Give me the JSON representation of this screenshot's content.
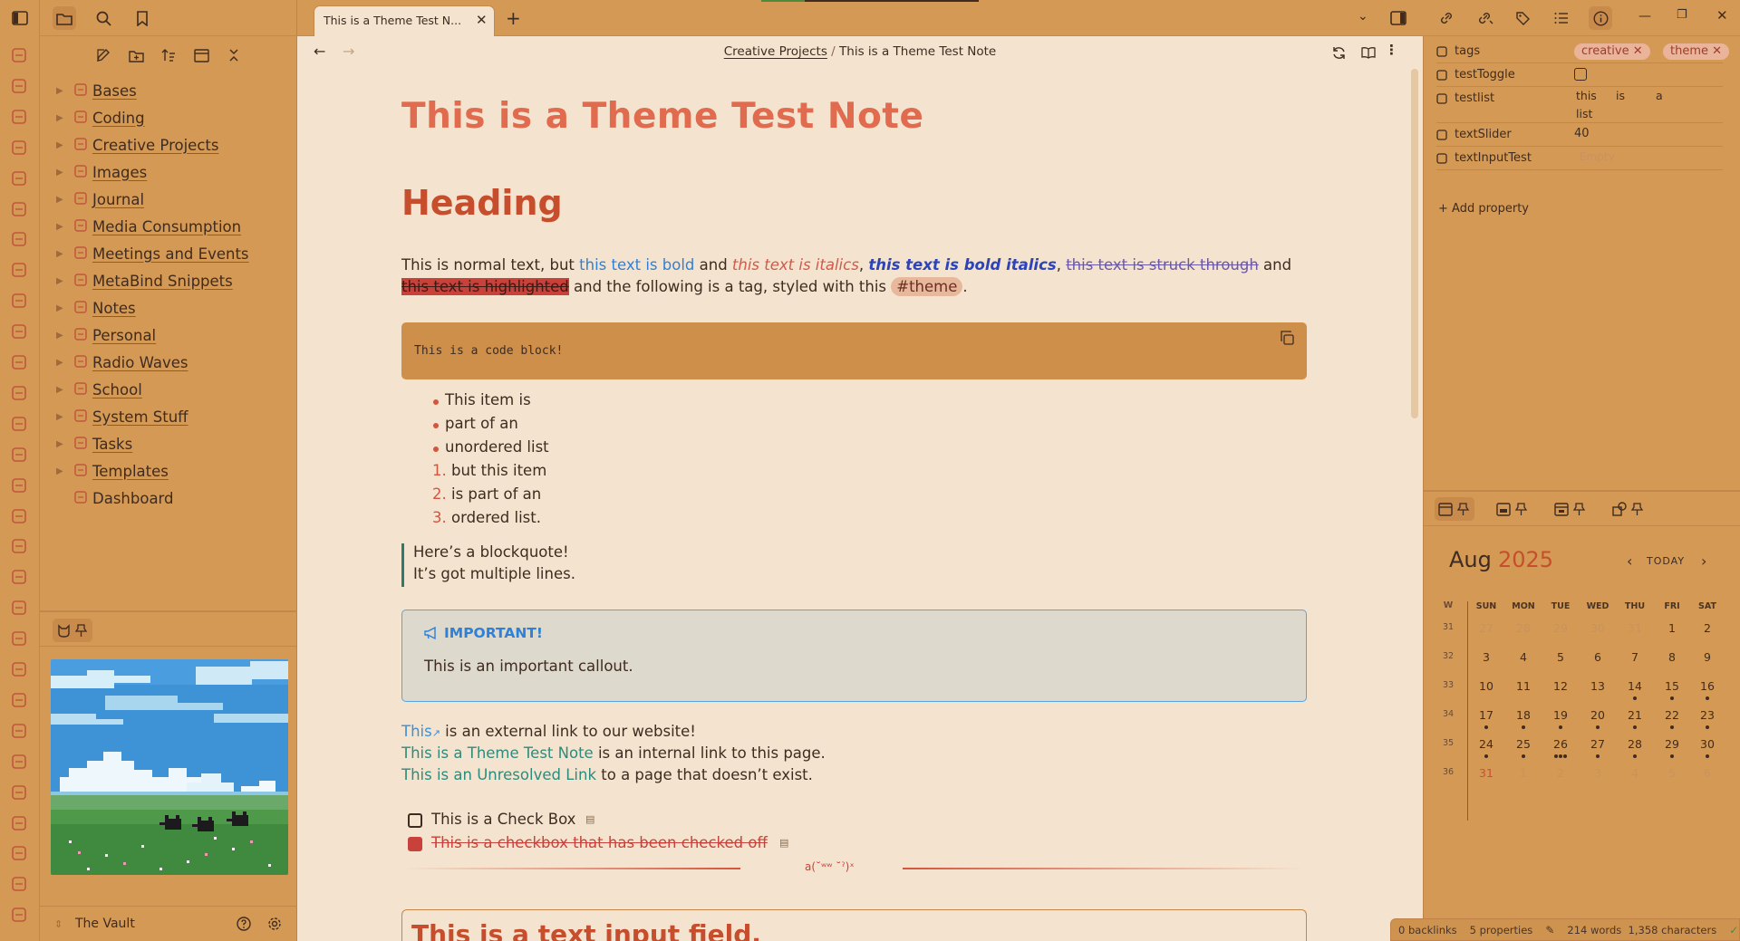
{
  "tab": {
    "title": "This is a Theme Test N..."
  },
  "breadcrumb": {
    "folder": "Creative Projects",
    "separator": "/",
    "note": "This is a Theme Test Note"
  },
  "sidebar": {
    "items": [
      {
        "label": "Bases",
        "icon": "bases-icon"
      },
      {
        "label": "Coding",
        "icon": "coding-icon"
      },
      {
        "label": "Creative Projects",
        "icon": "palette-icon"
      },
      {
        "label": "Images",
        "icon": "image-icon"
      },
      {
        "label": "Journal",
        "icon": "journal-icon"
      },
      {
        "label": "Media Consumption",
        "icon": "media-icon"
      },
      {
        "label": "Meetings and Events",
        "icon": "meetings-icon"
      },
      {
        "label": "MetaBind Snippets",
        "icon": "scissors-icon"
      },
      {
        "label": "Notes",
        "icon": "notes-icon"
      },
      {
        "label": "Personal",
        "icon": "person-icon"
      },
      {
        "label": "Radio Waves",
        "icon": "radio-icon"
      },
      {
        "label": "School",
        "icon": "school-icon"
      },
      {
        "label": "System Stuff",
        "icon": "system-icon"
      },
      {
        "label": "Tasks",
        "icon": "tasks-icon"
      },
      {
        "label": "Templates",
        "icon": "templates-icon"
      },
      {
        "label": "Dashboard",
        "icon": "dashboard-icon"
      }
    ],
    "vault_name": "The Vault"
  },
  "note": {
    "title": "This is a Theme Test Note",
    "heading": "Heading",
    "para1": {
      "t1": "This is normal text, but ",
      "bold": "this text is bold",
      "t2": " and ",
      "italic": "this text is italics",
      "t3": ", ",
      "bolditalic": "this text is bold italics",
      "t4": ", ",
      "strike": "this text is struck through",
      "t5": " and",
      "highlight": "this text is highlighted",
      "t6": " and the following is a tag, styled with this ",
      "tag": "#theme",
      "t7": "."
    },
    "code": "This is a code block!",
    "unordered": [
      "This item is",
      "part of an",
      "unordered list"
    ],
    "ordered": [
      {
        "n": "1.",
        "text": "but this item"
      },
      {
        "n": "2.",
        "text": "is part of an"
      },
      {
        "n": "3.",
        "text": "ordered list."
      }
    ],
    "blockquote": [
      "Here’s a blockquote!",
      "It’s got multiple lines."
    ],
    "callout": {
      "title": "IMPORTANT!",
      "body": "This is an important callout."
    },
    "links": {
      "ext_link": "This",
      "ext_rest": " is an external link to our website!",
      "int_link": "This is a Theme Test Note",
      "int_rest": " is an internal link to this page.",
      "unres_link": "This is an Unresolved Link",
      "unres_rest": " to a page that doesn’t exist."
    },
    "checkboxes": [
      {
        "label": "This is a Check Box",
        "checked": false
      },
      {
        "label": "This is a checkbox that has been checked off",
        "checked": true
      }
    ],
    "divider_glyph": "a(˘ʷʷ ˘ˀ)ˣ",
    "input_field": "This is a text input field."
  },
  "properties": {
    "rows": [
      {
        "key": "tags",
        "icon": "tag-icon"
      },
      {
        "key": "testToggle",
        "icon": "checkbox-icon"
      },
      {
        "key": "testlist",
        "icon": "list-icon"
      },
      {
        "key": "textSlider",
        "icon": "slider-icon"
      },
      {
        "key": "textInputTest",
        "icon": "text-icon"
      }
    ],
    "tags": [
      "creative",
      "theme"
    ],
    "testToggle": false,
    "testlist": [
      "this",
      "is",
      "a",
      "list"
    ],
    "textSlider": "40",
    "textInputTest_placeholder": "Empty",
    "add_label": "Add property"
  },
  "calendar": {
    "month": "Aug",
    "year": "2025",
    "today_label": "TODAY",
    "week_header": "W",
    "day_headers": [
      "SUN",
      "MON",
      "TUE",
      "WED",
      "THU",
      "FRI",
      "SAT"
    ],
    "weeks": [
      {
        "w": "31",
        "days": [
          "27",
          "28",
          "29",
          "30",
          "31",
          "1",
          "2"
        ],
        "dots": [
          0,
          0,
          0,
          0,
          0,
          0,
          0
        ]
      },
      {
        "w": "32",
        "days": [
          "3",
          "4",
          "5",
          "6",
          "7",
          "8",
          "9"
        ],
        "dots": [
          0,
          0,
          0,
          0,
          0,
          0,
          0
        ]
      },
      {
        "w": "33",
        "days": [
          "10",
          "11",
          "12",
          "13",
          "14",
          "15",
          "16"
        ],
        "dots": [
          0,
          0,
          0,
          0,
          1,
          1,
          1
        ]
      },
      {
        "w": "34",
        "days": [
          "17",
          "18",
          "19",
          "20",
          "21",
          "22",
          "23"
        ],
        "dots": [
          1,
          1,
          1,
          1,
          1,
          1,
          1
        ]
      },
      {
        "w": "35",
        "days": [
          "24",
          "25",
          "26",
          "27",
          "28",
          "29",
          "30"
        ],
        "dots": [
          1,
          1,
          3,
          1,
          1,
          1,
          1
        ]
      },
      {
        "w": "36",
        "days": [
          "31",
          "1",
          "2",
          "3",
          "4",
          "5",
          "6"
        ],
        "dots": [
          0,
          0,
          0,
          0,
          0,
          0,
          0
        ]
      }
    ]
  },
  "status": {
    "backlinks": "0 backlinks",
    "properties": "5 properties",
    "counts": "214 words  1,358 characters"
  },
  "colors": {
    "accent": "#e06b4e",
    "sidebar": "#d49a55",
    "page": "#f4e4cf",
    "link": "#3d8fd7",
    "internal": "#2f8a7c"
  }
}
